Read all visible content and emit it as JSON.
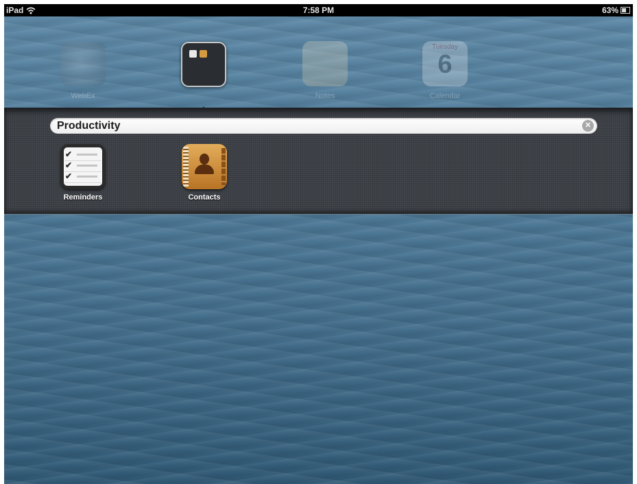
{
  "status_bar": {
    "device": "iPad",
    "time": "7:58 PM",
    "battery": "63%",
    "battery_level": 0.63
  },
  "home_row": {
    "apps": [
      {
        "label": "WebEx",
        "icon": "webex-icon"
      },
      {
        "label": "Notes",
        "icon": "notes-icon"
      },
      {
        "label": "Calendar",
        "icon": "calendar-icon",
        "day": "Tuesday",
        "date": "6"
      }
    ],
    "folder_icon": "folder-icon"
  },
  "folder": {
    "name": "Productivity",
    "clear_icon": "clear-text-icon",
    "apps": [
      {
        "label": "Reminders",
        "icon": "reminders-icon"
      },
      {
        "label": "Contacts",
        "icon": "contacts-icon"
      }
    ]
  }
}
